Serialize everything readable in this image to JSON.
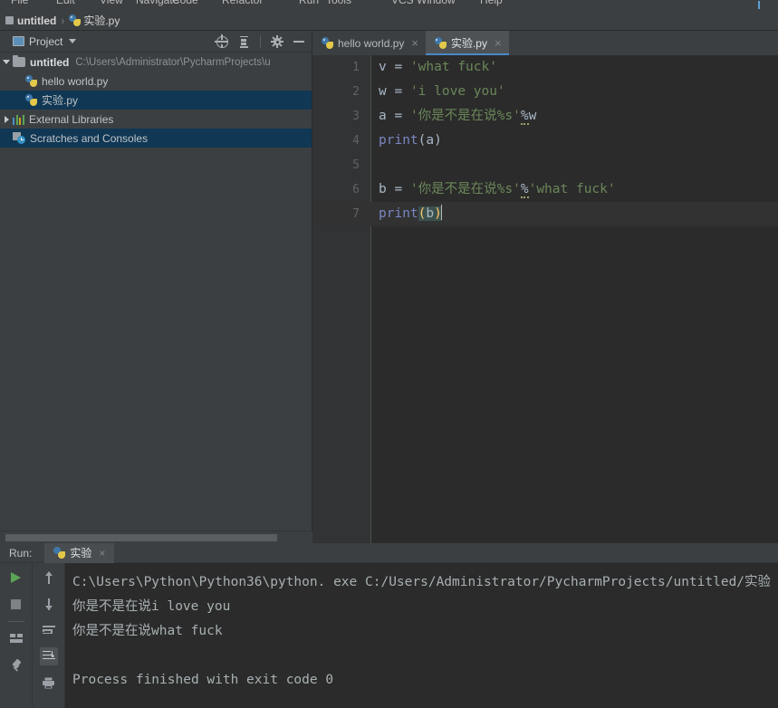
{
  "menubar": {
    "items": [
      "File",
      "Edit",
      "View",
      "Navigate",
      "Code",
      "Refactor",
      "Run",
      "Tools",
      "VCS",
      "Window",
      "Help"
    ]
  },
  "breadcrumb": {
    "project": "untitled",
    "separator": "›",
    "file": "实验.py",
    "module_icon": "module-icon",
    "file_icon": "python-file-icon"
  },
  "project_panel": {
    "title": "Project",
    "dropdown_icon": "chevron-down-icon",
    "toolbar": [
      {
        "name": "locate-file-icon",
        "label": "Select Opened File"
      },
      {
        "name": "collapse-all-icon",
        "label": "Collapse All"
      },
      {
        "name": "gear-icon",
        "label": "Settings"
      },
      {
        "name": "minimize-icon",
        "label": "Hide"
      }
    ],
    "tree": [
      {
        "label": "untitled",
        "path": "C:\\Users\\Administrator\\PycharmProjects\\u",
        "icon": "folder-icon",
        "twisty": "expanded",
        "indent": 0,
        "selected": false,
        "bold": true
      },
      {
        "label": "hello world.py",
        "path": "",
        "icon": "python-file-icon",
        "twisty": "none",
        "indent": 1,
        "selected": false,
        "bold": false
      },
      {
        "label": "实验.py",
        "path": "",
        "icon": "python-file-icon",
        "twisty": "none",
        "indent": 1,
        "selected": true,
        "bold": false
      },
      {
        "label": "External Libraries",
        "path": "",
        "icon": "libraries-icon",
        "twisty": "collapsed",
        "indent": 0,
        "selected": false,
        "bold": false
      },
      {
        "label": "Scratches and Consoles",
        "path": "",
        "icon": "scratches-icon",
        "twisty": "none",
        "indent": 0,
        "selected": true,
        "bold": false
      }
    ]
  },
  "editor": {
    "tabs": [
      {
        "label": "hello world.py",
        "active": false,
        "close": "×"
      },
      {
        "label": "实验.py",
        "active": true,
        "close": "×"
      }
    ],
    "lines": [
      {
        "num": "1",
        "current": false,
        "tokens": [
          {
            "t": "v ",
            "c": "plain"
          },
          {
            "t": "= ",
            "c": "plain"
          },
          {
            "t": "'what fuck'",
            "c": "str"
          }
        ]
      },
      {
        "num": "2",
        "current": false,
        "tokens": [
          {
            "t": "w ",
            "c": "plain"
          },
          {
            "t": "= ",
            "c": "plain"
          },
          {
            "t": "'i love you'",
            "c": "str"
          }
        ]
      },
      {
        "num": "3",
        "current": false,
        "tokens": [
          {
            "t": "a ",
            "c": "plain"
          },
          {
            "t": "= ",
            "c": "plain"
          },
          {
            "t": "'你是不是在说%s'",
            "c": "str"
          },
          {
            "t": "%",
            "c": "wavy"
          },
          {
            "t": "w",
            "c": "plain"
          }
        ]
      },
      {
        "num": "4",
        "current": false,
        "tokens": [
          {
            "t": "print",
            "c": "kw"
          },
          {
            "t": "(a)",
            "c": "plain"
          }
        ]
      },
      {
        "num": "5",
        "current": false,
        "tokens": []
      },
      {
        "num": "6",
        "current": false,
        "tokens": [
          {
            "t": "b ",
            "c": "plain"
          },
          {
            "t": "= ",
            "c": "plain"
          },
          {
            "t": "'你是不是在说%s'",
            "c": "str"
          },
          {
            "t": "%",
            "c": "wavy"
          },
          {
            "t": "'what fuck'",
            "c": "str"
          }
        ]
      },
      {
        "num": "7",
        "current": true,
        "tokens": [
          {
            "t": "print",
            "c": "kw"
          },
          {
            "t": "(",
            "c": "paren"
          },
          {
            "t": "b",
            "c": "ident-hl"
          },
          {
            "t": ")",
            "c": "paren"
          }
        ]
      }
    ]
  },
  "run_panel": {
    "label": "Run:",
    "tab": {
      "label": "实验",
      "close": "×",
      "icon": "python-run-icon"
    },
    "tools_left": [
      {
        "name": "run-icon",
        "label": "Rerun"
      },
      {
        "name": "stop-icon",
        "label": "Stop"
      },
      {
        "name": "divider",
        "label": ""
      },
      {
        "name": "layout-rows-icon",
        "label": "Toggle Tasks"
      },
      {
        "name": "pin-tab-icon",
        "label": "Pin Tab"
      }
    ],
    "tools_right": [
      {
        "name": "arrow-up-icon",
        "label": "Up the Stack Trace"
      },
      {
        "name": "arrow-down-icon",
        "label": "Down the Stack Trace"
      },
      {
        "name": "soft-wrap-icon",
        "label": "Use Soft Wraps"
      },
      {
        "name": "scroll-to-end-icon",
        "label": "Scroll to End",
        "active": true
      },
      {
        "name": "print-icon",
        "label": "Print"
      }
    ],
    "console": [
      "C:\\Users\\Python\\Python36\\python. exe C:/Users/Administrator/PycharmProjects/untitled/实验",
      "你是不是在说i love you",
      "你是不是在说what fuck",
      "",
      "Process finished with exit code 0"
    ]
  },
  "colors": {
    "panel_bg": "#3c3f41",
    "editor_bg": "#2b2b2b",
    "gutter_bg": "#313335",
    "selection": "#103754",
    "tab_active_underline": "#4a88c7",
    "string": "#6a8759",
    "keyword": "#7b86c4",
    "paren_match": "#ffc66d",
    "run_green": "#5aa555"
  }
}
